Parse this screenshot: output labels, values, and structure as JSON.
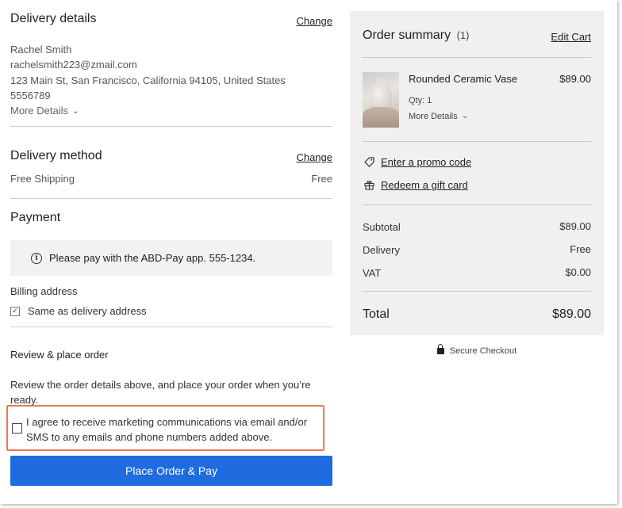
{
  "delivery_details": {
    "title": "Delivery details",
    "change_label": "Change",
    "name": "Rachel Smith",
    "email": "rachelsmith223@zmail.com",
    "address": "123 Main St, San Francisco, California 94105, United States",
    "phone": "5556789",
    "more_details": "More Details"
  },
  "delivery_method": {
    "title": "Delivery method",
    "change_label": "Change",
    "option": "Free Shipping",
    "price": "Free"
  },
  "payment": {
    "title": "Payment",
    "info_text": "Please pay with the ABD-Pay app.  555-1234.",
    "billing_label": "Billing address",
    "same_as_delivery": "Same as delivery address",
    "same_as_delivery_checked": true
  },
  "review": {
    "title": "Review & place order",
    "description": "Review the order details above, and place your order when you’re ready.",
    "consent_text": "I agree to receive marketing communications via email and/or SMS to any emails and phone numbers added above.",
    "consent_checked": false,
    "place_order_label": "Place Order & Pay"
  },
  "summary": {
    "title": "Order summary",
    "count": "(1)",
    "edit_cart": "Edit Cart",
    "item": {
      "name": "Rounded Ceramic Vase",
      "price": "$89.00",
      "qty": "Qty: 1",
      "more_details": "More Details"
    },
    "promo_label": "Enter a promo code",
    "gift_label": "Redeem a gift card",
    "rows": [
      {
        "label": "Subtotal",
        "value": "$89.00"
      },
      {
        "label": "Delivery",
        "value": "Free"
      },
      {
        "label": "VAT",
        "value": "$0.00"
      }
    ],
    "total_label": "Total",
    "total_value": "$89.00"
  },
  "secure_checkout": "Secure Checkout",
  "icons": {
    "info": "info-icon",
    "chevron": "chevron-down-icon",
    "tag": "tag-icon",
    "gift": "gift-icon",
    "lock": "lock-icon",
    "check": "checkmark-icon"
  },
  "colors": {
    "primary_button": "#1e6ce0",
    "highlight_border": "#e8795b",
    "summary_bg": "#f0f0f0"
  }
}
